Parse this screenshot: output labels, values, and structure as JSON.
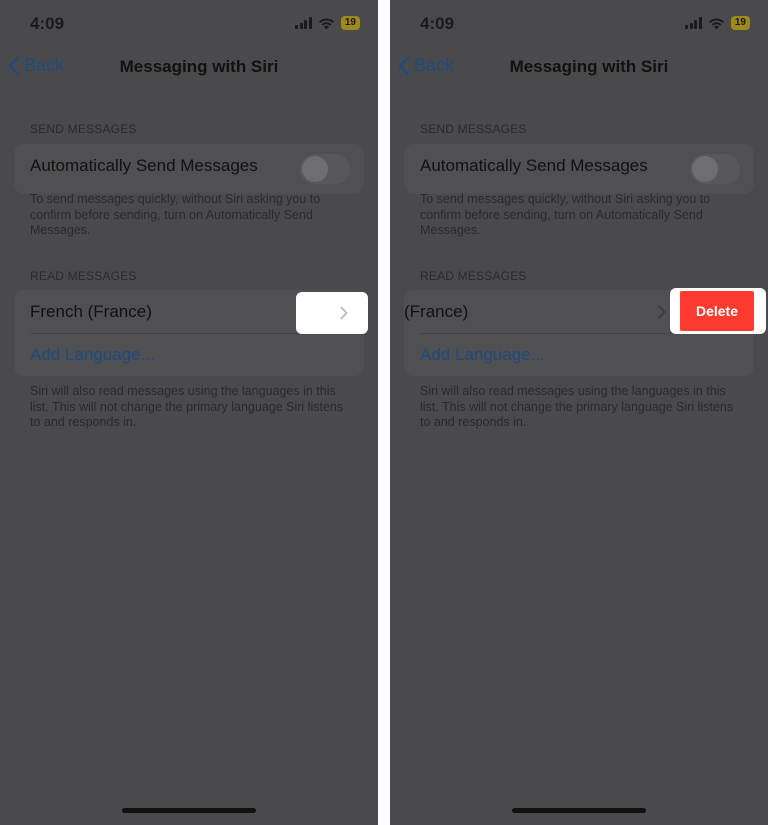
{
  "status": {
    "time": "4:09",
    "battery": "19"
  },
  "nav": {
    "back_label": "Back",
    "title": "Messaging with Siri"
  },
  "send": {
    "header": "SEND MESSAGES",
    "toggle_label": "Automatically Send Messages",
    "toggle_on": false,
    "footer": "To send messages quickly, without Siri asking you to confirm before sending, turn on Automatically Send Messages."
  },
  "read": {
    "header": "READ MESSAGES",
    "language": "French (France)",
    "language_swiped": "(France)",
    "add_language": "Add Language...",
    "footer": "Siri will also read messages using the languages in this list. This will not change the primary language Siri listens to and responds in."
  },
  "delete_label": "Delete",
  "colors": {
    "delete": "#ff3b30",
    "link": "#1e4a7d",
    "background_dimmed": "#4a4a4d"
  }
}
